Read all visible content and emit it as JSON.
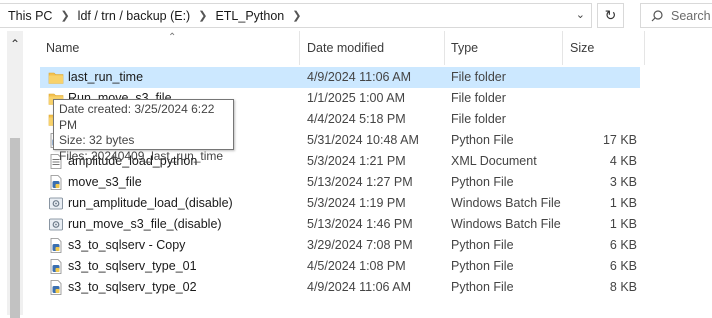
{
  "address": {
    "breadcrumbs": [
      "This PC",
      "ldf / trn / backup (E:)",
      "ETL_Python"
    ]
  },
  "search": {
    "placeholder": "Search"
  },
  "columns": {
    "name": "Name",
    "date": "Date modified",
    "type": "Type",
    "size": "Size"
  },
  "files": [
    {
      "name": "last_run_time",
      "date": "4/9/2024 11:06 AM",
      "type": "File folder",
      "size": "",
      "icon": "folder-icon"
    },
    {
      "name": "Run_move_s3_file",
      "date": "1/1/2025 1:00 AM",
      "type": "File folder",
      "size": "",
      "icon": "folder-icon"
    },
    {
      "name": "",
      "date": "4/4/2024 5:18 PM",
      "type": "File folder",
      "size": "",
      "icon": "folder-icon"
    },
    {
      "name": "",
      "date": "5/31/2024 10:48 AM",
      "type": "Python File",
      "size": "17 KB",
      "icon": "python-file-icon"
    },
    {
      "name": "amplitude_load_python",
      "date": "5/3/2024 1:21 PM",
      "type": "XML Document",
      "size": "4 KB",
      "icon": "xml-file-icon"
    },
    {
      "name": "move_s3_file",
      "date": "5/13/2024 1:27 PM",
      "type": "Python File",
      "size": "3 KB",
      "icon": "python-file-icon"
    },
    {
      "name": "run_amplitude_load_(disable)",
      "date": "5/3/2024 1:19 PM",
      "type": "Windows Batch File",
      "size": "1 KB",
      "icon": "batch-file-icon"
    },
    {
      "name": "run_move_s3_file_(disable)",
      "date": "5/13/2024 1:46 PM",
      "type": "Windows Batch File",
      "size": "1 KB",
      "icon": "batch-file-icon"
    },
    {
      "name": "s3_to_sqlserv - Copy",
      "date": "3/29/2024 7:08 PM",
      "type": "Python File",
      "size": "6 KB",
      "icon": "python-file-icon"
    },
    {
      "name": "s3_to_sqlserv_type_01",
      "date": "4/5/2024 1:08 PM",
      "type": "Python File",
      "size": "6 KB",
      "icon": "python-file-icon"
    },
    {
      "name": "s3_to_sqlserv_type_02",
      "date": "4/9/2024 11:06 AM",
      "type": "Python File",
      "size": "8 KB",
      "icon": "python-file-icon"
    }
  ],
  "tooltip": {
    "created": "Date created: 3/25/2024 6:22 PM",
    "size": "Size: 32 bytes",
    "files": "Files: 20240409_last_run_time"
  },
  "colors": {
    "selection": "#cce8ff",
    "folder": "#f4c14f",
    "python": "#3a6fb0"
  }
}
